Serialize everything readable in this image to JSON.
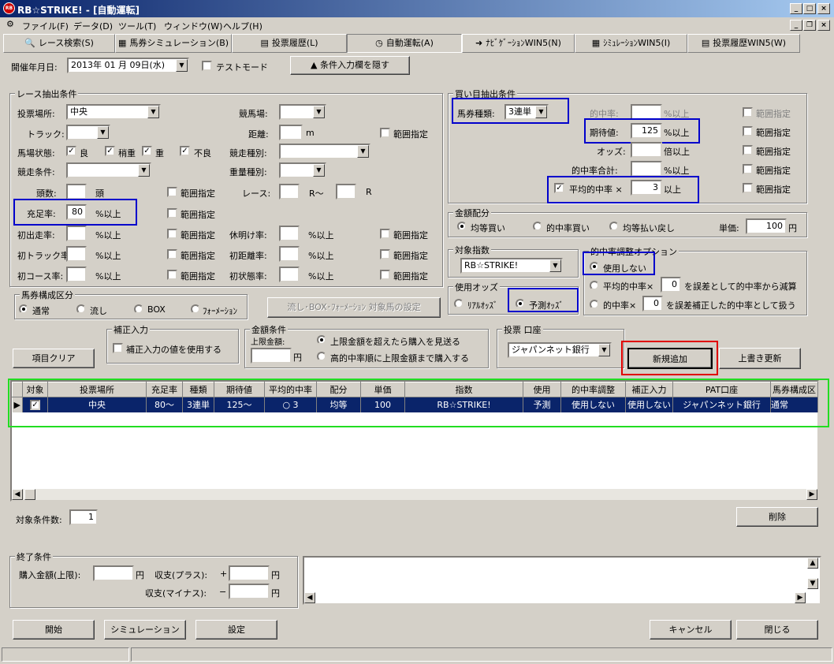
{
  "window": {
    "title": "RB☆STRIKE! - [自動運転]",
    "app_icon": "RB"
  },
  "menu": [
    "ファイル(F)",
    "データ(D)",
    "ツール(T)",
    "ウィンドウ(W)",
    "ヘルプ(H)"
  ],
  "tabs": [
    "レース検索(S)",
    "馬券シミュレーション(B)",
    "投票履歴(L)",
    "自動運転(A)",
    "ﾅﾋﾞｹﾞｰｼｮﾝWIN5(N)",
    "ｼﾐｭﾚｰｼｮﾝWIN5(I)",
    "投票履歴WIN5(W)"
  ],
  "top": {
    "date_label": "開催年月日:",
    "date_value": "2013年 01 月 09日(水)",
    "test_mode": "テストモード",
    "hide_button": "▲ 条件入力欄を隠す"
  },
  "race": {
    "title": "レース抽出条件",
    "venue_label": "投票場所:",
    "venue_value": "中央",
    "track_label": "トラック:",
    "condition_label": "馬場状態:",
    "cond_good": "良",
    "cond_slightly": "稍重",
    "cond_heavy": "重",
    "cond_bad": "不良",
    "race_cond_label": "競走条件:",
    "heads_label": "頭数:",
    "heads_unit": "頭",
    "fill_label": "充足率:",
    "fill_value": "80",
    "fill_unit": "%以上",
    "first_run_label": "初出走率:",
    "first_track_label": "初トラック率:",
    "first_course_label": "初コース率:",
    "pct_unit": "%以上",
    "range": "範囲指定",
    "track_venue_label": "競馬場:",
    "distance_label": "距離:",
    "distance_unit": "m",
    "race_type_label": "競走種別:",
    "weight_label": "重量種別:",
    "race_label": "レース:",
    "race_unit1": "R〜",
    "race_unit2": "R",
    "rest_label": "休明け率:",
    "first_dist_label": "初距離率:",
    "first_state_label": "初状態率:"
  },
  "bet": {
    "title": "買い目抽出条件",
    "type_label": "馬券種類:",
    "type_value": "3連単",
    "hit_label": "的中率:",
    "hit_unit": "%以上",
    "ev_label": "期待値:",
    "ev_value": "125",
    "ev_unit": "%以上",
    "odds_label": "オッズ:",
    "odds_unit": "倍以上",
    "hit_sum_label": "的中率合計:",
    "hit_sum_unit": "%以上",
    "avg_label": "平均的中率 ×",
    "avg_value": "3",
    "avg_unit": "以上",
    "range": "範囲指定"
  },
  "money": {
    "title": "金額配分",
    "opt1": "均等買い",
    "opt2": "的中率買い",
    "opt3": "均等払い戻し",
    "unit_label": "単価:",
    "unit_value": "100",
    "unit_suffix": "円"
  },
  "index": {
    "title": "対象指数",
    "value": "RB☆STRIKE!"
  },
  "odds": {
    "title": "使用オッズ",
    "opt1": "ﾘｱﾙｵｯｽﾞ",
    "opt2": "予測ｵｯｽﾞ"
  },
  "adjust": {
    "title": "的中率調整オプション",
    "opt1": "使用しない",
    "opt2a": "平均的中率×",
    "opt2_val": "0",
    "opt2b": "を誤差として的中率から減算",
    "opt3a": "的中率×",
    "opt3_val": "0",
    "opt3b": "を誤差補正した的中率として扱う"
  },
  "horse": {
    "title": "馬券構成区分",
    "opt1": "通常",
    "opt2": "流し",
    "opt3": "BOX",
    "opt4": "ﾌｫｰﾒｰｼｮﾝ",
    "setting_button": "流し･BOX･ﾌｫｰﾒｰｼｮﾝ 対象馬の設定"
  },
  "correction": {
    "title": "補正入力",
    "check": "補正入力の値を使用する"
  },
  "amount": {
    "title": "金額条件",
    "limit_label": "上限金額:",
    "unit": "円",
    "opt1": "上限金額を超えたら購入を見送る",
    "opt2": "高的中率順に上限金額まで購入する"
  },
  "account": {
    "title": "投票 口座",
    "value": "ジャパンネット銀行"
  },
  "buttons": {
    "clear": "項目クリア",
    "add": "新規追加",
    "overwrite": "上書き更新",
    "delete": "削除",
    "start": "開始",
    "simulation": "シミュレーション",
    "settings": "設定",
    "cancel": "キャンセル",
    "close": "閉じる"
  },
  "grid": {
    "headers": [
      "対象",
      "投票場所",
      "充足率",
      "種類",
      "期待値",
      "平均的中率",
      "配分",
      "単価",
      "指数",
      "使用",
      "的中率調整",
      "補正入力",
      "PAT口座",
      "馬券構成区"
    ],
    "rows": [
      [
        "",
        "中央",
        "80〜",
        "3連単",
        "125〜",
        "○ 3",
        "均等",
        "100",
        "RB☆STRIKE!",
        "予測",
        "使用しない",
        "使用しない",
        "ジャパンネット銀行",
        "通常"
      ]
    ]
  },
  "count": {
    "label": "対象条件数:",
    "value": "1"
  },
  "end": {
    "title": "終了条件",
    "purchase_label": "購入金額(上限):",
    "yen": "円",
    "plus_label": "収支(プラス):",
    "plus_sign": "+",
    "minus_label": "収支(マイナス):",
    "minus_sign": "−"
  },
  "colors": {
    "highlight_blue": "#0000cc",
    "highlight_red": "#e00000",
    "highlight_green": "#22dd22",
    "selection": "#0a246a"
  }
}
